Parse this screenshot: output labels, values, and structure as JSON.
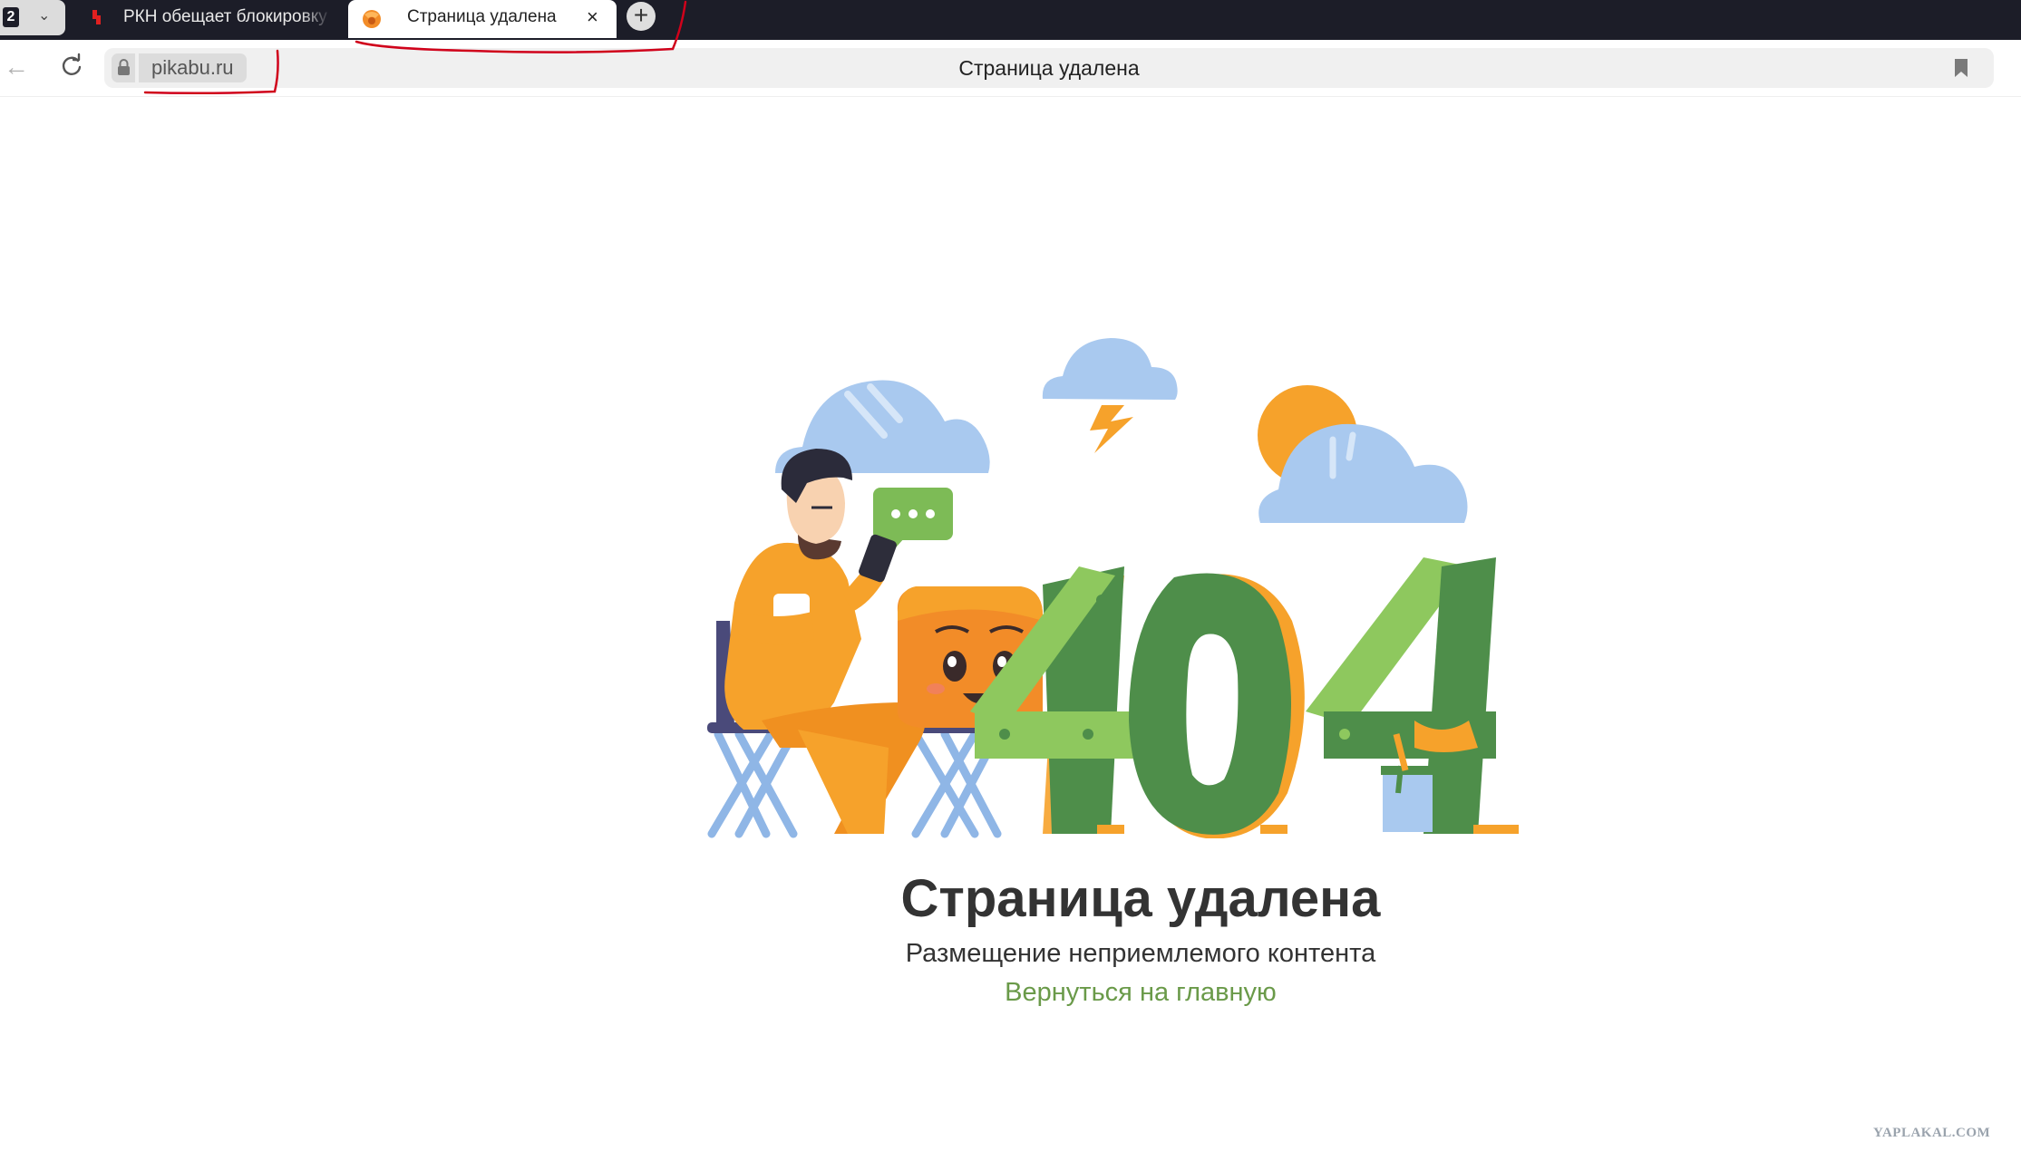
{
  "browser": {
    "tab_count": "2",
    "tabs": [
      {
        "title": "РКН обещает блокировку",
        "active": false,
        "favicon": "yandex-red-icon"
      },
      {
        "title": "Страница удалена",
        "active": true,
        "favicon": "pikabu-icon"
      }
    ],
    "close_tab_glyph": "×",
    "new_tab_glyph": "+",
    "back_glyph": "←",
    "address": {
      "domain": "pikabu.ru",
      "page_title": "Страница удалена",
      "secure_icon": "lock-icon"
    }
  },
  "page": {
    "illustration": {
      "number": "404",
      "icons": [
        "cloud-icon",
        "lightning-icon",
        "sun-icon",
        "speech-bubble-icon",
        "person-with-phone",
        "pikabu-mascot"
      ]
    },
    "heading": "Страница удалена",
    "subtext": "Размещение неприемлемого контента",
    "home_link": "Вернуться на главную"
  },
  "watermark": "YAPLAKAL.COM",
  "colors": {
    "tabbar_bg": "#1c1d28",
    "link_green": "#6a9a49",
    "annotation_red": "#d0021b",
    "digit_green": "#4e8e4a",
    "digit_light_green": "#8ec85e",
    "orange": "#f6a22b"
  }
}
